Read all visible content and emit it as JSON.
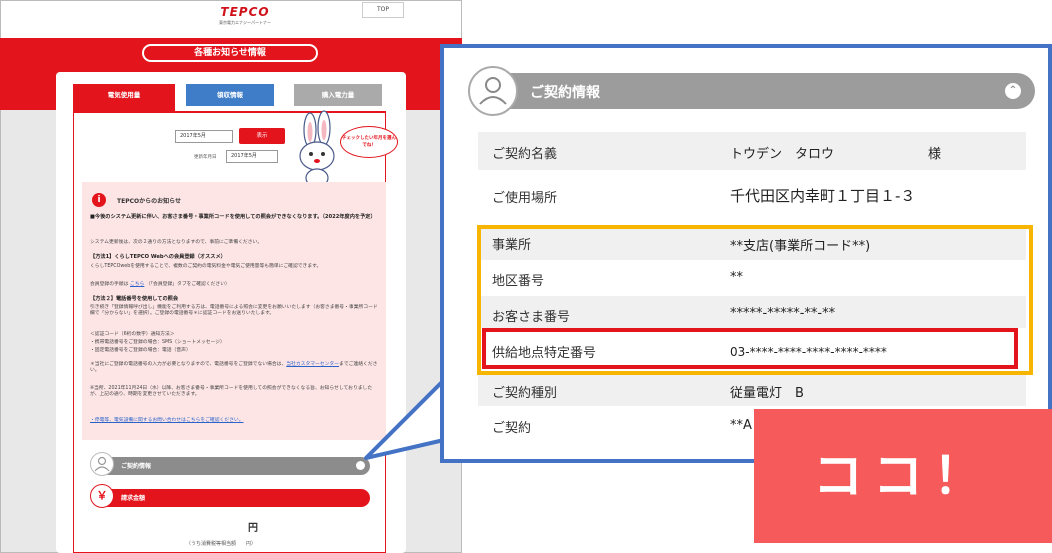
{
  "header": {
    "logo": "TEPCO",
    "logo_sub": "東京電力エナジーパートナー",
    "top_button": "TOP"
  },
  "page_title": "各種お知らせ情報",
  "tabs": [
    {
      "label": "電気使用量"
    },
    {
      "label": "領収情報"
    },
    {
      "label": "購入電力量"
    }
  ],
  "date_picker": {
    "value": "2017年5月",
    "show_button": "表示",
    "updated_label": "更新年月日",
    "updated_value": "2017年5月"
  },
  "mascot_bubble": "チェックしたい年月を選んでね！",
  "notice": {
    "title": "TEPCOからのお知らせ",
    "lines": [
      "■今後のシステム更新に伴い、お客さま番号・事業所コードを使用しての照会ができなくなります。（2022年度内を予定）",
      "システム更新後は、次の２通りの方法となりますので、事前にご準備ください。",
      "【方法1】くらしTEPCO Webへの会員登録（オススメ）",
      "くらしTEPCOwebを使用することで、複数のご契約の電気料金や電気ご使用量等も簡単にご確認できます。",
      "会員登録の手順は",
      "【方法２】電話番号を使用しての照会",
      "引き続き「登録情報呼び出し」機能をご利用する方は、電話番号による照会に変更をお願いいたします（お客さま番号・事業所コード欄で「分からない」を選択）。ご登録の電話番号＊に認証コードをお送りいたします。",
      "＜認証コード（6桁の数字）通知方法＞",
      "・携帯電話番号をご登録の場合：SMS（ショートメッセージ）",
      "・固定電話番号をご登録の場合：電話（音声）",
      "＊当社にご登録の電話番号の入力が必要となりますので、電話番号をご登録でない場合は、",
      "※当所、2021年11月24日（水）以降、お客さま番号・事業所コードを使用しての照会ができなくなる旨、お知らせしておりましたが、上記の通り、時期を変更させていただきます。",
      "・停電等、電気設備に関するお問い合わせはこちらをご確認ください。"
    ],
    "link_here": "こちら",
    "member_tab_hint": "（「会員登録」タブをご確認ください）",
    "callcenter_link": "当社カスタマーセンター",
    "callcenter_suffix": "までご連絡ください。"
  },
  "sections": {
    "contract_info": "ご契約情報",
    "billing": "請求金額",
    "billing_icon": "￥",
    "yen": "円",
    "tax_note": "（うち消費税等相当額　　円）"
  },
  "detail": {
    "title": "ご契約情報",
    "rows": [
      {
        "label": "ご契約名義",
        "value": "トウデン　タロウ",
        "suffix": "様"
      },
      {
        "label": "ご使用場所",
        "value": "千代田区内幸町１丁目１-３"
      },
      {
        "label": "事業所",
        "value": "**支店(事業所コード**)"
      },
      {
        "label": "地区番号",
        "value": "**"
      },
      {
        "label": "お客さま番号",
        "value": "*****-*****-**-**"
      },
      {
        "label": "供給地点特定番号",
        "value": "03-****-****-****-****-****"
      },
      {
        "label": "ご契約種別",
        "value": "従量電灯　B"
      },
      {
        "label": "ご契約",
        "value": "**A"
      }
    ]
  },
  "callout_label": "ココ！",
  "colors": {
    "tepco_red": "#e3141c",
    "callout_blue": "#4472c4",
    "highlight_yellow": "#f7b500",
    "koko_red": "#f75a5a"
  }
}
